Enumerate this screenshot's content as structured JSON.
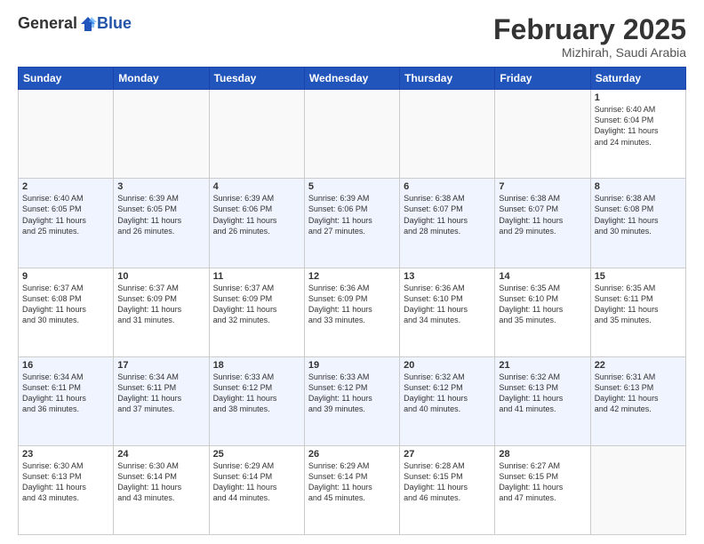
{
  "header": {
    "logo_general": "General",
    "logo_blue": "Blue",
    "month_title": "February 2025",
    "subtitle": "Mizhirah, Saudi Arabia"
  },
  "weekdays": [
    "Sunday",
    "Monday",
    "Tuesday",
    "Wednesday",
    "Thursday",
    "Friday",
    "Saturday"
  ],
  "weeks": [
    [
      {
        "day": "",
        "info": ""
      },
      {
        "day": "",
        "info": ""
      },
      {
        "day": "",
        "info": ""
      },
      {
        "day": "",
        "info": ""
      },
      {
        "day": "",
        "info": ""
      },
      {
        "day": "",
        "info": ""
      },
      {
        "day": "1",
        "info": "Sunrise: 6:40 AM\nSunset: 6:04 PM\nDaylight: 11 hours\nand 24 minutes."
      }
    ],
    [
      {
        "day": "2",
        "info": "Sunrise: 6:40 AM\nSunset: 6:05 PM\nDaylight: 11 hours\nand 25 minutes."
      },
      {
        "day": "3",
        "info": "Sunrise: 6:39 AM\nSunset: 6:05 PM\nDaylight: 11 hours\nand 26 minutes."
      },
      {
        "day": "4",
        "info": "Sunrise: 6:39 AM\nSunset: 6:06 PM\nDaylight: 11 hours\nand 26 minutes."
      },
      {
        "day": "5",
        "info": "Sunrise: 6:39 AM\nSunset: 6:06 PM\nDaylight: 11 hours\nand 27 minutes."
      },
      {
        "day": "6",
        "info": "Sunrise: 6:38 AM\nSunset: 6:07 PM\nDaylight: 11 hours\nand 28 minutes."
      },
      {
        "day": "7",
        "info": "Sunrise: 6:38 AM\nSunset: 6:07 PM\nDaylight: 11 hours\nand 29 minutes."
      },
      {
        "day": "8",
        "info": "Sunrise: 6:38 AM\nSunset: 6:08 PM\nDaylight: 11 hours\nand 30 minutes."
      }
    ],
    [
      {
        "day": "9",
        "info": "Sunrise: 6:37 AM\nSunset: 6:08 PM\nDaylight: 11 hours\nand 30 minutes."
      },
      {
        "day": "10",
        "info": "Sunrise: 6:37 AM\nSunset: 6:09 PM\nDaylight: 11 hours\nand 31 minutes."
      },
      {
        "day": "11",
        "info": "Sunrise: 6:37 AM\nSunset: 6:09 PM\nDaylight: 11 hours\nand 32 minutes."
      },
      {
        "day": "12",
        "info": "Sunrise: 6:36 AM\nSunset: 6:09 PM\nDaylight: 11 hours\nand 33 minutes."
      },
      {
        "day": "13",
        "info": "Sunrise: 6:36 AM\nSunset: 6:10 PM\nDaylight: 11 hours\nand 34 minutes."
      },
      {
        "day": "14",
        "info": "Sunrise: 6:35 AM\nSunset: 6:10 PM\nDaylight: 11 hours\nand 35 minutes."
      },
      {
        "day": "15",
        "info": "Sunrise: 6:35 AM\nSunset: 6:11 PM\nDaylight: 11 hours\nand 35 minutes."
      }
    ],
    [
      {
        "day": "16",
        "info": "Sunrise: 6:34 AM\nSunset: 6:11 PM\nDaylight: 11 hours\nand 36 minutes."
      },
      {
        "day": "17",
        "info": "Sunrise: 6:34 AM\nSunset: 6:11 PM\nDaylight: 11 hours\nand 37 minutes."
      },
      {
        "day": "18",
        "info": "Sunrise: 6:33 AM\nSunset: 6:12 PM\nDaylight: 11 hours\nand 38 minutes."
      },
      {
        "day": "19",
        "info": "Sunrise: 6:33 AM\nSunset: 6:12 PM\nDaylight: 11 hours\nand 39 minutes."
      },
      {
        "day": "20",
        "info": "Sunrise: 6:32 AM\nSunset: 6:12 PM\nDaylight: 11 hours\nand 40 minutes."
      },
      {
        "day": "21",
        "info": "Sunrise: 6:32 AM\nSunset: 6:13 PM\nDaylight: 11 hours\nand 41 minutes."
      },
      {
        "day": "22",
        "info": "Sunrise: 6:31 AM\nSunset: 6:13 PM\nDaylight: 11 hours\nand 42 minutes."
      }
    ],
    [
      {
        "day": "23",
        "info": "Sunrise: 6:30 AM\nSunset: 6:13 PM\nDaylight: 11 hours\nand 43 minutes."
      },
      {
        "day": "24",
        "info": "Sunrise: 6:30 AM\nSunset: 6:14 PM\nDaylight: 11 hours\nand 43 minutes."
      },
      {
        "day": "25",
        "info": "Sunrise: 6:29 AM\nSunset: 6:14 PM\nDaylight: 11 hours\nand 44 minutes."
      },
      {
        "day": "26",
        "info": "Sunrise: 6:29 AM\nSunset: 6:14 PM\nDaylight: 11 hours\nand 45 minutes."
      },
      {
        "day": "27",
        "info": "Sunrise: 6:28 AM\nSunset: 6:15 PM\nDaylight: 11 hours\nand 46 minutes."
      },
      {
        "day": "28",
        "info": "Sunrise: 6:27 AM\nSunset: 6:15 PM\nDaylight: 11 hours\nand 47 minutes."
      },
      {
        "day": "",
        "info": ""
      }
    ]
  ]
}
